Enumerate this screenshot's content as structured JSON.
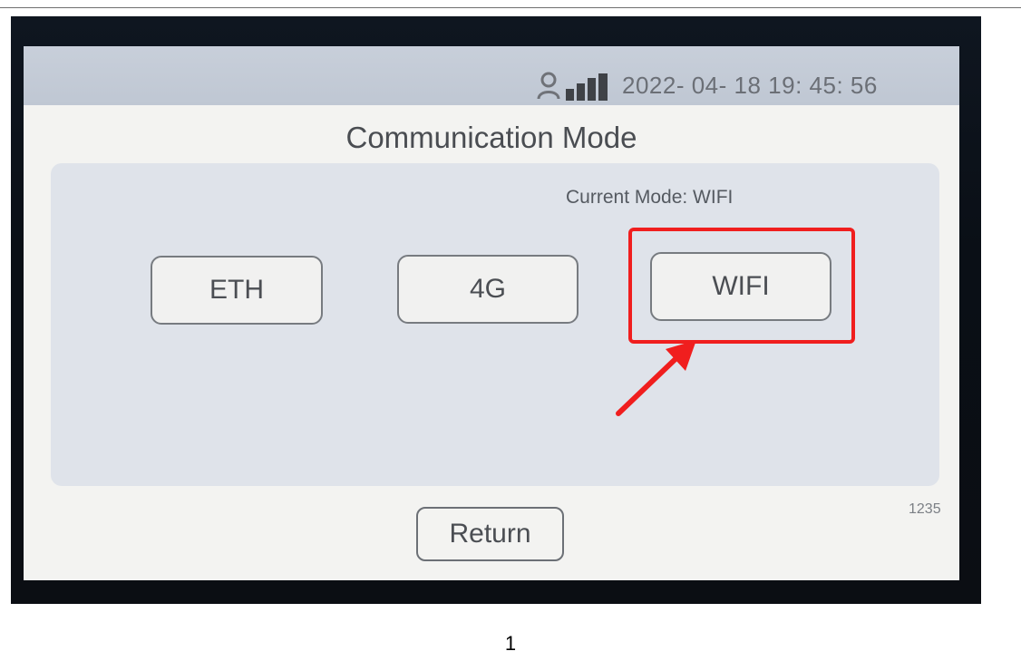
{
  "status_bar": {
    "datetime": "2022- 04- 18  19: 45: 56",
    "icons": [
      "user-icon",
      "signal-strength-icon"
    ]
  },
  "screen": {
    "title": "Communication Mode",
    "current_mode_text": "Current Mode: WIFI",
    "modes": [
      {
        "label": "ETH"
      },
      {
        "label": "4G"
      },
      {
        "label": "WIFI"
      }
    ],
    "return_label": "Return",
    "page_code": "1235"
  },
  "annotation": {
    "highlight_color": "#f01e1e",
    "highlighted_mode": "WIFI"
  },
  "document": {
    "page_number": "1"
  },
  "colors": {
    "status_bar_bg": "#c2c9d5",
    "panel_bg": "#dfe3ea",
    "screen_bg": "#f3f3f1",
    "annotation_red": "#f01e1e"
  }
}
